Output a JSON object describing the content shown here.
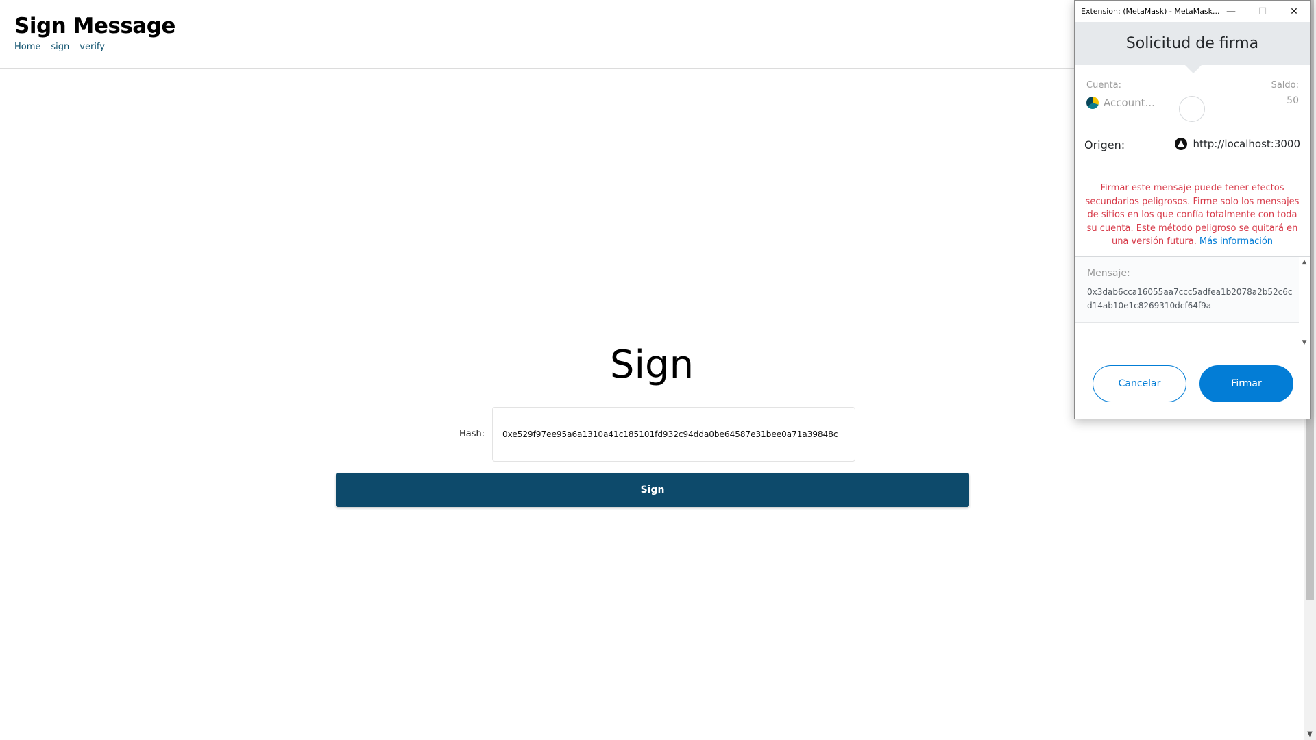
{
  "site": {
    "title": "Sign Message",
    "nav": [
      "Home",
      "sign",
      "verify"
    ]
  },
  "main": {
    "heading": "Sign",
    "hash_label": "Hash:",
    "hash_value": "0xe529f97ee95a6a1310a41c185101fd932c94dda0be64587e31bee0a71a39848c",
    "sign_button": "Sign"
  },
  "popup": {
    "window_title": "Extension: (MetaMask) - MetaMask...",
    "window_controls": [
      "—",
      "☐",
      "✕"
    ],
    "banner_title": "Solicitud de firma",
    "account_label": "Cuenta:",
    "account_name": "Account...",
    "balance_label": "Saldo:",
    "balance_value": "50",
    "origin_label": "Origen:",
    "origin_value": "http://localhost:3000",
    "warning_text": "Firmar este mensaje puede tener efectos secundarios peligrosos. Firme solo los mensajes de sitios en los que confía totalmente con toda su cuenta. Este método peligroso se quitará en una versión futura.",
    "warning_link": "Más información",
    "message_label": "Mensaje:",
    "message_value": "0x3dab6cca16055aa7ccc5adfea1b2078a2b52c6cd14ab10e1c8269310dcf64f9a",
    "cancel_button": "Cancelar",
    "confirm_button": "Firmar"
  },
  "colors": {
    "nav_link": "#0b4f6c",
    "sign_button_bg": "#0d4a6b",
    "metamask_blue": "#037dd6",
    "warning_red": "#d73a49",
    "banner_bg": "#e6e9ec"
  },
  "icons": {
    "account_avatar": "account-identicon",
    "origin": "origin-site-icon",
    "scroll_up": "▲",
    "scroll_down": "▼"
  }
}
